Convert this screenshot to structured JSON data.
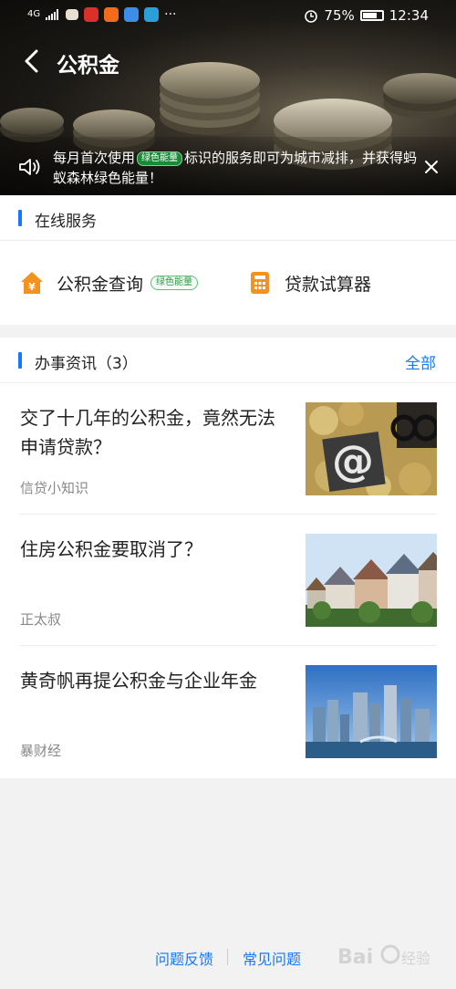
{
  "status_bar": {
    "network": "4G",
    "battery": "75%",
    "battery_fraction": 0.75,
    "time": "12:34",
    "more": "···"
  },
  "header": {
    "title": "公积金"
  },
  "notice": {
    "text_before": "每月首次使用",
    "badge": "绿色能量",
    "text_after": "标识的服务即可为城市减排，并获得蚂蚁森林绿色能量！"
  },
  "online_services": {
    "title": "在线服务",
    "items": [
      {
        "label": "公积金查询",
        "badge": "绿色能量"
      },
      {
        "label": "贷款试算器"
      }
    ]
  },
  "news": {
    "title": "办事资讯（3）",
    "more": "全部",
    "items": [
      {
        "title": "交了十几年的公积金，竟然无法申请贷款？",
        "source": "信贷小知识"
      },
      {
        "title": "住房公积金要取消了？",
        "source": "正太叔"
      },
      {
        "title": "黄奇帆再提公积金与企业年金",
        "source": "暴财经"
      }
    ]
  },
  "footer": {
    "feedback": "问题反馈",
    "faq": "常见问题"
  },
  "colors": {
    "accent": "#1677ff",
    "service_orange": "#f5921e",
    "green_badge": "#2d9a4a"
  },
  "icons": {
    "back": "chevron-left-icon",
    "speaker": "speaker-icon",
    "close": "close-icon",
    "house": "house-yen-icon",
    "calculator": "calculator-icon"
  }
}
